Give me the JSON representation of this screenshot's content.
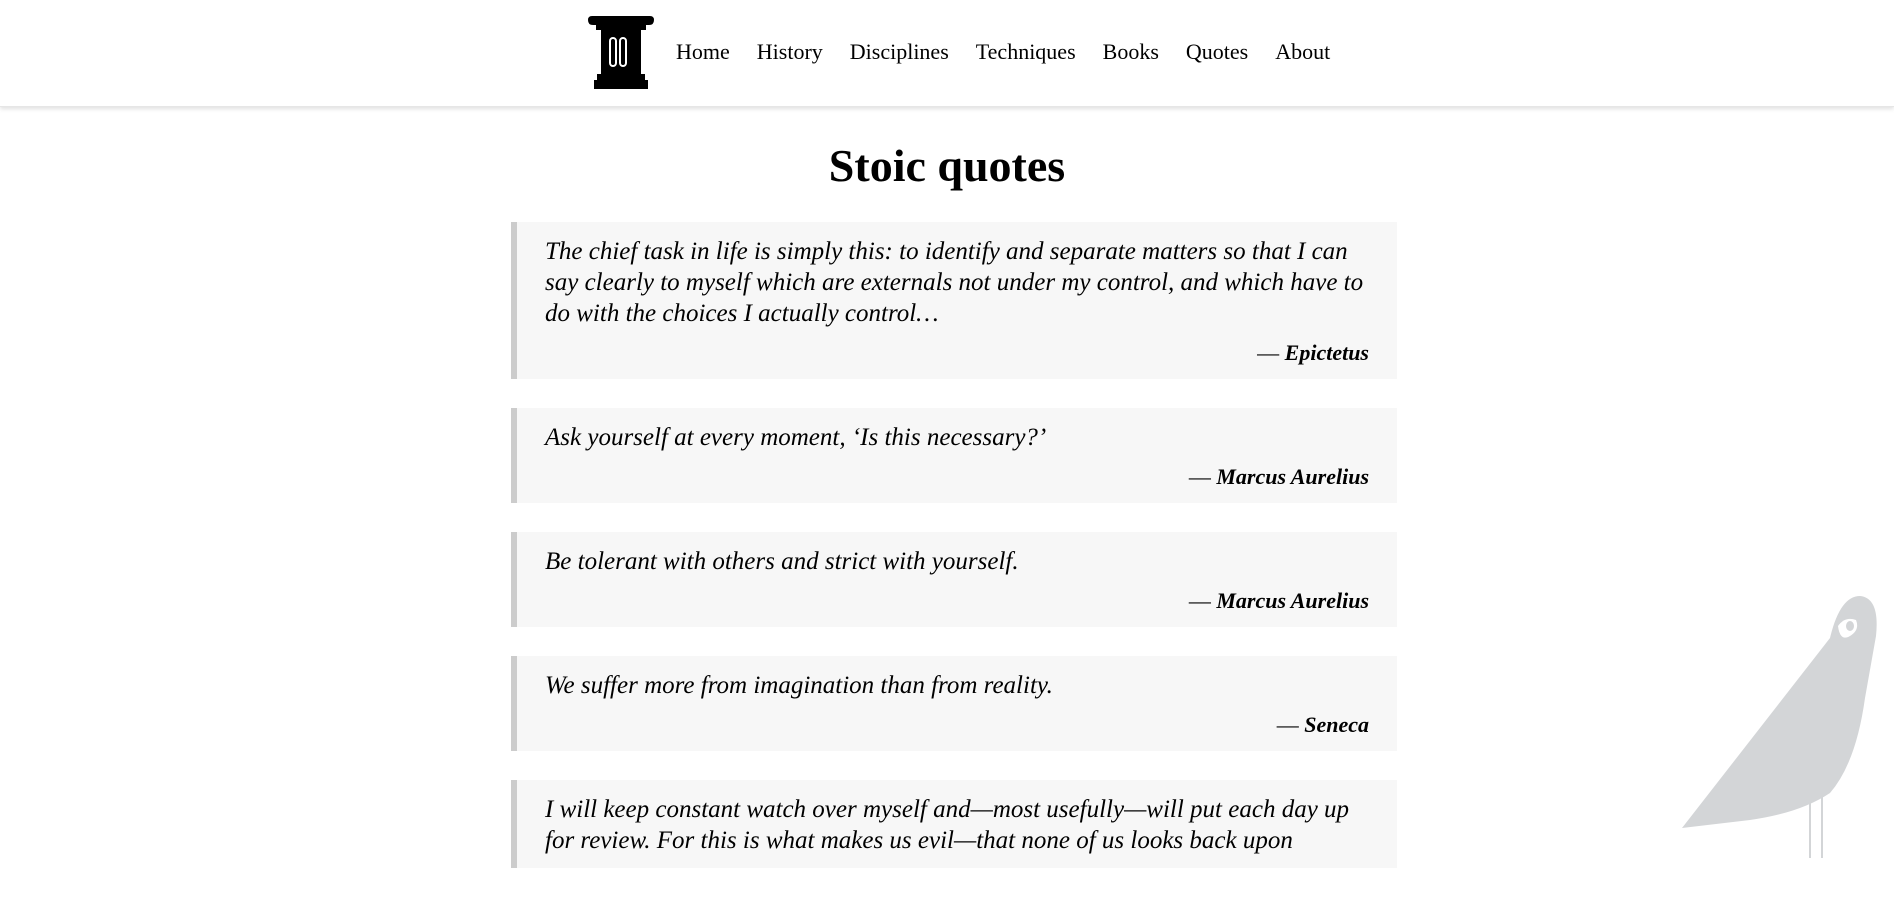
{
  "header": {
    "logo": "ionic-column-icon",
    "nav": [
      {
        "label": "Home"
      },
      {
        "label": "History"
      },
      {
        "label": "Disciplines"
      },
      {
        "label": "Techniques"
      },
      {
        "label": "Books"
      },
      {
        "label": "Quotes"
      },
      {
        "label": "About"
      }
    ]
  },
  "main": {
    "title": "Stoic quotes",
    "quotes": [
      {
        "text": "The chief task in life is simply this: to identify and separate matters so that I can say clearly to myself which are externals not under my control, and which have to do with the choices I actually control…",
        "dash": "— ",
        "author": "Epictetus"
      },
      {
        "text": "Ask yourself at every moment, ‘Is this necessary?’",
        "dash": "— ",
        "author": "Marcus Aurelius"
      },
      {
        "text": "Be tolerant with others and strict with yourself.",
        "dash": "— ",
        "author": "Marcus Aurelius"
      },
      {
        "text": "We suffer more from imagination than from reality.",
        "dash": "— ",
        "author": "Seneca"
      },
      {
        "text": "I will keep constant watch over myself and—most usefully—will put each day up for review. For this is what makes us evil—that none of us looks back upon",
        "dash": "",
        "author": ""
      }
    ]
  },
  "decor": {
    "bird": "bird-illustration-icon",
    "bird_color": "#d3d5d7",
    "quote_bg": "#f7f7f7",
    "quote_border": "#cccccc"
  }
}
